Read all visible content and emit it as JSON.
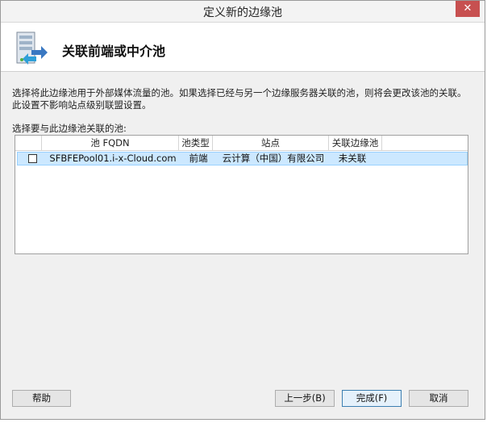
{
  "window": {
    "title": "定义新的边缘池",
    "close_label": "✕"
  },
  "header": {
    "title": "关联前端或中介池",
    "icon": "pool-wizard-icon"
  },
  "description": "选择将此边缘池用于外部媒体流量的池。如果选择已经与另一个边缘服务器关联的池，则将会更改该池的关联。此设置不影响站点级别联盟设置。",
  "table": {
    "label": "选择要与此边缘池关联的池:",
    "columns": [
      "池 FQDN",
      "池类型",
      "站点",
      "关联边缘池"
    ],
    "rows": [
      {
        "checked": false,
        "fqdn": "SFBFEPool01.i-x-Cloud.com",
        "type": "前端",
        "site": "云计算（中国）有限公司",
        "associated": "未关联"
      }
    ]
  },
  "buttons": {
    "help": "帮助",
    "back": "上一步(B)",
    "finish": "完成(F)",
    "cancel": "取消"
  }
}
